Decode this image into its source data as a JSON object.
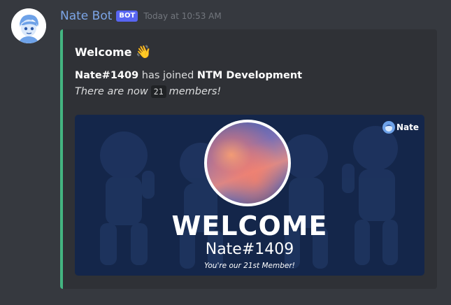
{
  "message": {
    "username": "Nate Bot",
    "badge": "BOT",
    "timestamp": "Today at 10:53 AM",
    "avatar_icon": "anime-boy-avatar-icon"
  },
  "embed": {
    "accent_color": "#43b581",
    "title": "Welcome",
    "title_emoji": "👋",
    "user_tag": "Nate#1409",
    "joined_text": " has joined ",
    "server_name": "NTM Development",
    "count_prefix": "There are now",
    "member_count": "21",
    "count_suffix": "members!"
  },
  "welcome_card": {
    "logo_text": "Nate",
    "heading": "WELCOME",
    "name": "Nate#1409",
    "subtitle": "You're our 21st Member!",
    "background_color": "#14264a"
  }
}
